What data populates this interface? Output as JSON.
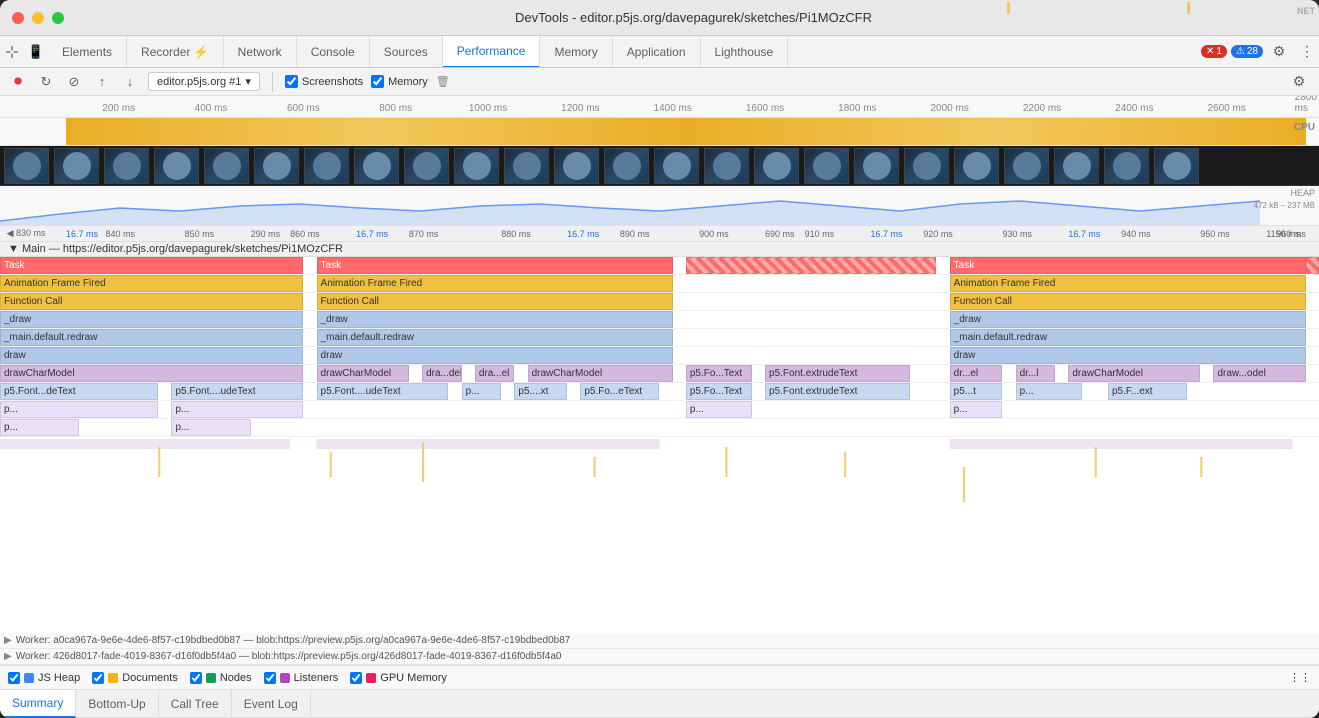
{
  "window": {
    "title": "DevTools - editor.p5js.org/davepagurek/sketches/Pi1MOzCFR"
  },
  "tabs": [
    {
      "label": "Elements",
      "active": false
    },
    {
      "label": "Recorder ⚡",
      "active": false
    },
    {
      "label": "Network",
      "active": false
    },
    {
      "label": "Console",
      "active": false
    },
    {
      "label": "Sources",
      "active": false
    },
    {
      "label": "Performance",
      "active": true
    },
    {
      "label": "Memory",
      "active": false
    },
    {
      "label": "Application",
      "active": false
    },
    {
      "label": "Lighthouse",
      "active": false
    }
  ],
  "perf_toolbar": {
    "url": "editor.p5js.org #1",
    "screenshots_label": "Screenshots",
    "memory_label": "Memory"
  },
  "time_ticks": [
    "200 ms",
    "400 ms",
    "600 ms",
    "800 ms",
    "1000 ms",
    "1200 ms",
    "1400 ms",
    "1600 ms",
    "1800 ms",
    "2000 ms",
    "2200 ms",
    "2400 ms",
    "2600 ms",
    "2800 ms"
  ],
  "cpu_label": "CPU",
  "net_label": "NET",
  "heap_label": "HEAP\n472 kB – 237 MB",
  "mini_ticks": [
    "830 ms",
    "16.7 ms",
    "840 ms",
    "850 ms",
    "290 ms",
    "860 ms",
    "16.7 ms",
    "870 ms",
    "880 ms",
    "16.7 ms",
    "890 ms",
    "900 ms",
    "690 ms",
    "910 ms",
    "16.7 ms",
    "920 ms",
    "930 ms",
    "16.7 ms",
    "940 ms",
    "950 ms",
    "1150 ms",
    "960 ms"
  ],
  "main_label": "▼ Main — https://editor.p5js.org/davepagurek/sketches/Pi1MOzCFR",
  "flame_rows": {
    "task_label": "Task",
    "animation_label": "Animation Frame Fired",
    "function_call_label": "Function Call",
    "draw_label": "_draw",
    "main_redraw_label": "_main.default.redraw",
    "draw2_label": "draw",
    "draw_char_label": "drawCharModel",
    "font_label": "p5.Font...deText",
    "font2_label": "p5.Font.extrudeText",
    "p_label": "p...",
    "p2_label": "p..."
  },
  "workers": [
    {
      "label": "Worker: a0ca967a-9e6e-4de6-8f57-c19bdbed0b87 — blob:https://preview.p5js.org/a0ca967a-9e6e-4de6-8f57-c19bdbed0b87"
    },
    {
      "label": "Worker: 426d8017-fade-4019-8367-d16f0db5f4a0 — blob:https://preview.p5js.org/426d8017-fade-4019-8367-d16f0db5f4a0"
    }
  ],
  "memory_legend": [
    {
      "label": "JS Heap",
      "color": "#4285f4"
    },
    {
      "label": "Documents",
      "color": "#f4b400"
    },
    {
      "label": "Nodes",
      "color": "#0f9d58"
    },
    {
      "label": "Listeners",
      "color": "#ab47bc"
    },
    {
      "label": "GPU Memory",
      "color": "#e91e63"
    }
  ],
  "bottom_tabs": [
    {
      "label": "Summary",
      "active": true
    },
    {
      "label": "Bottom-Up",
      "active": false
    },
    {
      "label": "Call Tree",
      "active": false
    },
    {
      "label": "Event Log",
      "active": false
    }
  ],
  "badges": {
    "error": "1",
    "warning": "28"
  }
}
